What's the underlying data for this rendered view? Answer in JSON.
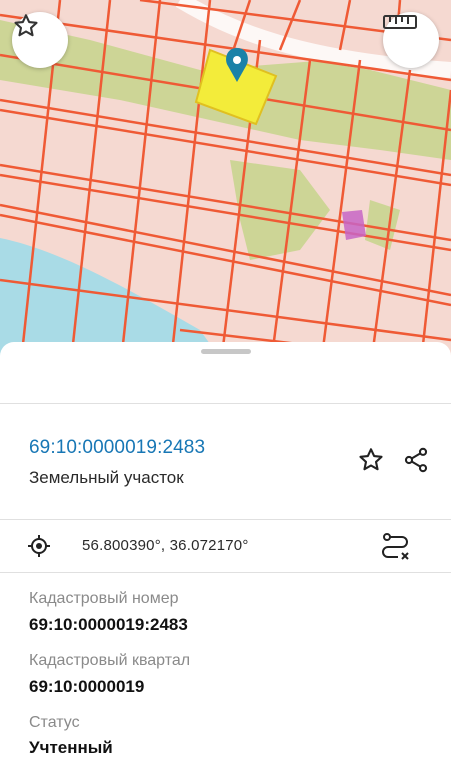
{
  "map": {
    "favorite_icon": "star-outline-icon",
    "ruler_icon": "ruler-icon",
    "pin_icon": "location-pin-icon",
    "colors": {
      "background": "#f5d9d1",
      "parcel_lines": "#ef5a35",
      "vegetation": "#c9d48f",
      "water": "#a9dbe6",
      "selected_parcel": "#f3ec3a",
      "pin": "#1a82a8",
      "building": "#c765c5"
    }
  },
  "object": {
    "cadastral_number_link": "69:10:0000019:2483",
    "type": "Земельный участок",
    "favorite_icon": "star-outline-icon",
    "share_icon": "share-icon"
  },
  "coordinates": {
    "text": "56.800390°, 36.072170°",
    "location_icon": "crosshair-icon",
    "route_icon": "route-icon"
  },
  "details": [
    {
      "label": "Кадастровый номер",
      "value": "69:10:0000019:2483"
    },
    {
      "label": "Кадастровый квартал",
      "value": "69:10:0000019"
    },
    {
      "label": "Статус",
      "value": "Учтенный"
    }
  ]
}
